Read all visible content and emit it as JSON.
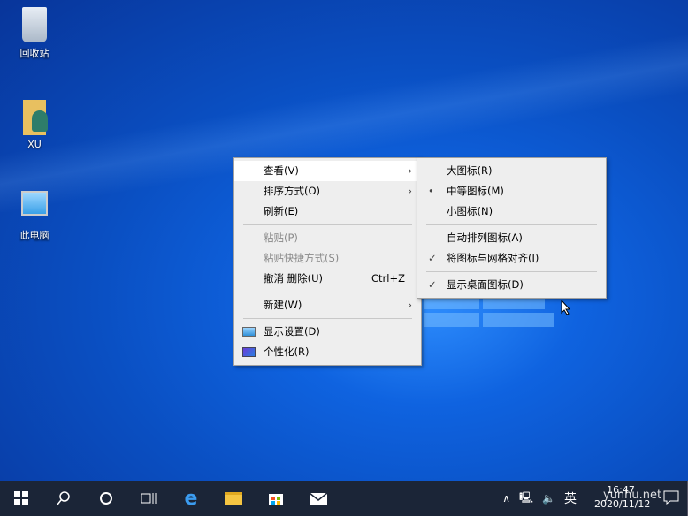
{
  "desktop_icons": [
    {
      "label": "回收站"
    },
    {
      "label": "XU"
    },
    {
      "label": "此电脑"
    }
  ],
  "context_menu": {
    "items": [
      {
        "label": "查看(V)",
        "submenu": true
      },
      {
        "label": "排序方式(O)",
        "submenu": true
      },
      {
        "label": "刷新(E)"
      },
      {
        "label": "粘贴(P)",
        "disabled": true
      },
      {
        "label": "粘贴快捷方式(S)",
        "disabled": true
      },
      {
        "label": "撤消 删除(U)",
        "shortcut": "Ctrl+Z"
      },
      {
        "label": "新建(W)",
        "submenu": true
      },
      {
        "label": "显示设置(D)",
        "icon": "display-icon"
      },
      {
        "label": "个性化(R)",
        "icon": "personalize-icon"
      }
    ]
  },
  "view_submenu": {
    "items": [
      {
        "label": "大图标(R)"
      },
      {
        "label": "中等图标(M)",
        "mark": "•"
      },
      {
        "label": "小图标(N)"
      },
      {
        "label": "自动排列图标(A)"
      },
      {
        "label": "将图标与网格对齐(I)",
        "mark": "✓"
      },
      {
        "label": "显示桌面图标(D)",
        "mark": "✓"
      }
    ]
  },
  "tray": {
    "ime": "英",
    "time": "16:47",
    "date": "2020/11/12"
  },
  "watermark": "yunhu.net"
}
